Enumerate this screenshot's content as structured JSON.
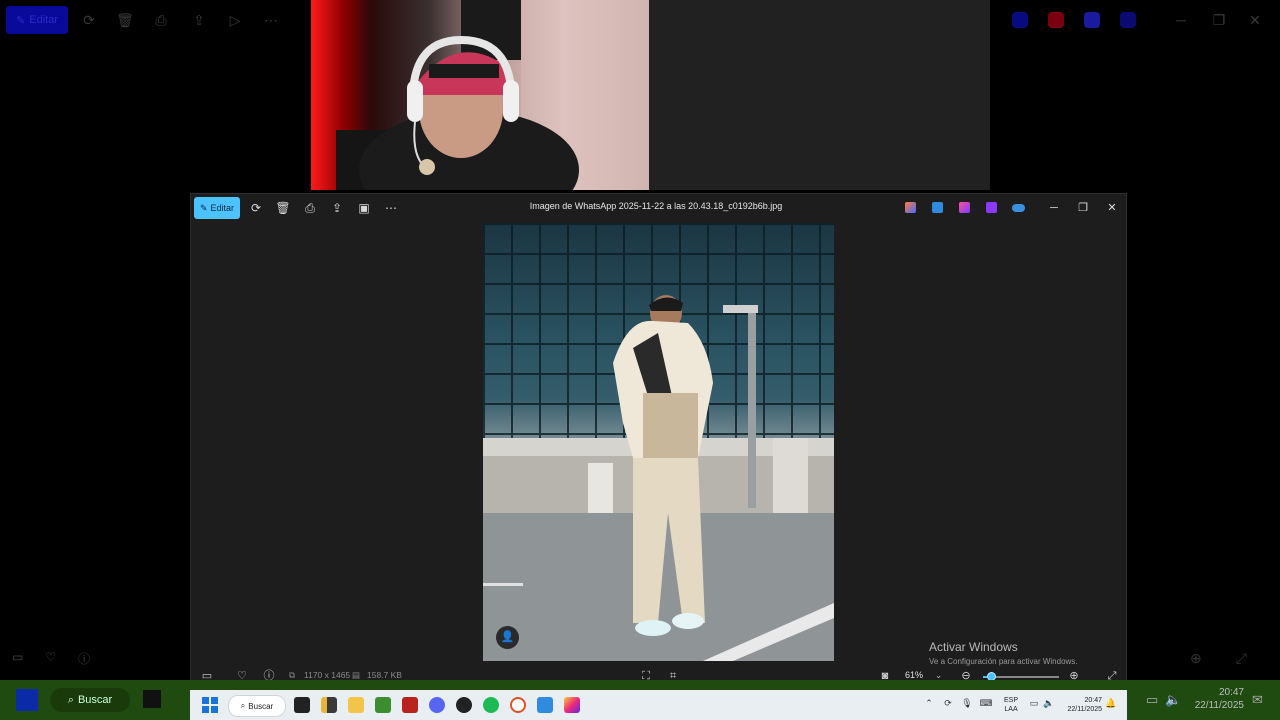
{
  "background": {
    "edit_label": "Editar",
    "edit_color": "#0a0a9a"
  },
  "window": {
    "title": "Imagen de WhatsApp 2025-11-22 a las 20.43.18_c0192b6b.jpg",
    "edit_label": "Editar",
    "accent_color": "#4cc2ff",
    "toolbar_icons": [
      "edit-icon",
      "rotate-icon",
      "trash-icon",
      "print-icon",
      "share-icon",
      "slideshow-icon",
      "more-icon"
    ],
    "apps": [
      "copilot-icon",
      "paint-icon",
      "clipchamp-icon",
      "designer-icon",
      "onedrive-icon"
    ],
    "controls": {
      "minimize": "─",
      "maximize": "❐",
      "close": "✕"
    }
  },
  "photo": {
    "people_tag_icon": "person-icon"
  },
  "bottombar": {
    "dimensions": "1170 x 1465",
    "file_size": "158.7 KB",
    "zoom": "61%",
    "zoom_level": 0.61
  },
  "watermark": {
    "title": "Activar Windows",
    "subtitle": "Ve a Configuración para activar Windows."
  },
  "outer_taskbar": {
    "search_label": "Buscar",
    "time": "20:47",
    "date": "22/11/2025"
  },
  "inner_taskbar": {
    "search_label": "Buscar",
    "lang_top": "ESP",
    "lang_bottom": "LAA",
    "time": "20:47",
    "date": "22/11/2025"
  }
}
